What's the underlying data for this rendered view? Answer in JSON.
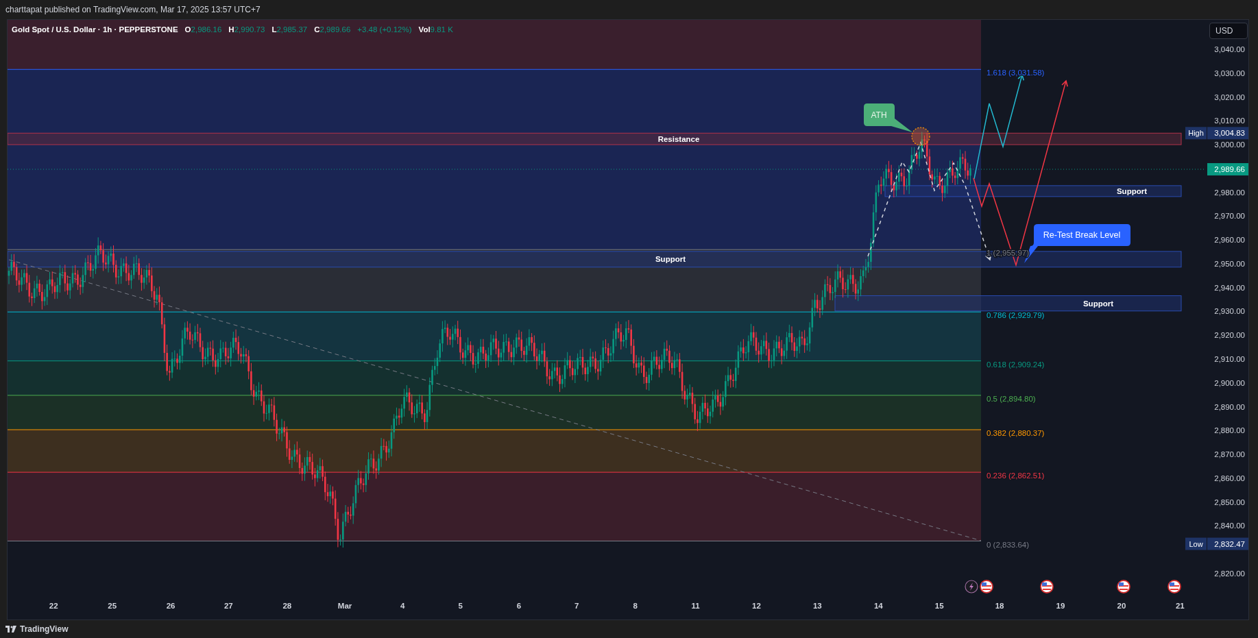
{
  "publisher_line": "charttapat published on TradingView.com, Mar 17, 2025 13:57 UTC+7",
  "legend": {
    "symbol": "Gold Spot / U.S. Dollar · 1h · PEPPERSTONE",
    "fields": [
      {
        "key": "O",
        "value": "2,986.16"
      },
      {
        "key": "H",
        "value": "2,990.73"
      },
      {
        "key": "L",
        "value": "2,985.37"
      },
      {
        "key": "C",
        "value": "2,989.66"
      }
    ],
    "change": "+3.48 (+0.12%)",
    "volume": {
      "key": "Vol",
      "value": "9.81 K"
    }
  },
  "currency": "USD",
  "price_axis": [
    "3,040.00",
    "3,030.00",
    "3,020.00",
    "3,010.00",
    "3,000.00",
    "2,980.00",
    "2,970.00",
    "2,960.00",
    "2,950.00",
    "2,940.00",
    "2,930.00",
    "2,920.00",
    "2,910.00",
    "2,900.00",
    "2,890.00",
    "2,880.00",
    "2,870.00",
    "2,860.00",
    "2,850.00",
    "2,840.00",
    "2,820.00"
  ],
  "price_labels": [
    {
      "kind": "high",
      "label": "High",
      "value": "3,004.83"
    },
    {
      "kind": "current",
      "value": "2,989.66"
    },
    {
      "kind": "low",
      "label": "Low",
      "value": "2,832.47"
    }
  ],
  "fib_levels": [
    {
      "label": "1.618 (3,031.58)",
      "color": "#2962ff"
    },
    {
      "label": "1 (2,955.97)",
      "color": "#787b86"
    },
    {
      "label": "0.786 (2,929.79)",
      "color": "#00bcd4"
    },
    {
      "label": "0.618 (2,909.24)",
      "color": "#089981"
    },
    {
      "label": "0.5 (2,894.80)",
      "color": "#4caf50"
    },
    {
      "label": "0.382 (2,880.37)",
      "color": "#ff9800"
    },
    {
      "label": "0.236 (2,862.51)",
      "color": "#f23645"
    },
    {
      "label": "0 (2,833.64)",
      "color": "#787b86"
    }
  ],
  "zones": [
    {
      "kind": "resistance",
      "label": "Resistance"
    },
    {
      "kind": "support",
      "label": "Support"
    },
    {
      "kind": "support",
      "label": "Support"
    },
    {
      "kind": "support",
      "label": "Support"
    }
  ],
  "callouts": [
    {
      "kind": "ath",
      "label": "ATH"
    },
    {
      "kind": "retest",
      "label": "Re-Test Break Level"
    }
  ],
  "time_axis": [
    "22",
    "25",
    "26",
    "27",
    "28",
    "Mar",
    "4",
    "5",
    "6",
    "7",
    "8",
    "11",
    "12",
    "13",
    "14",
    "15",
    "18",
    "19",
    "20",
    "21"
  ],
  "events": [
    {
      "kind": "lightning"
    },
    {
      "kind": "flag"
    },
    {
      "kind": "flag"
    },
    {
      "kind": "flag"
    },
    {
      "kind": "flag"
    }
  ],
  "footer": {
    "brand": "TradingView"
  }
}
